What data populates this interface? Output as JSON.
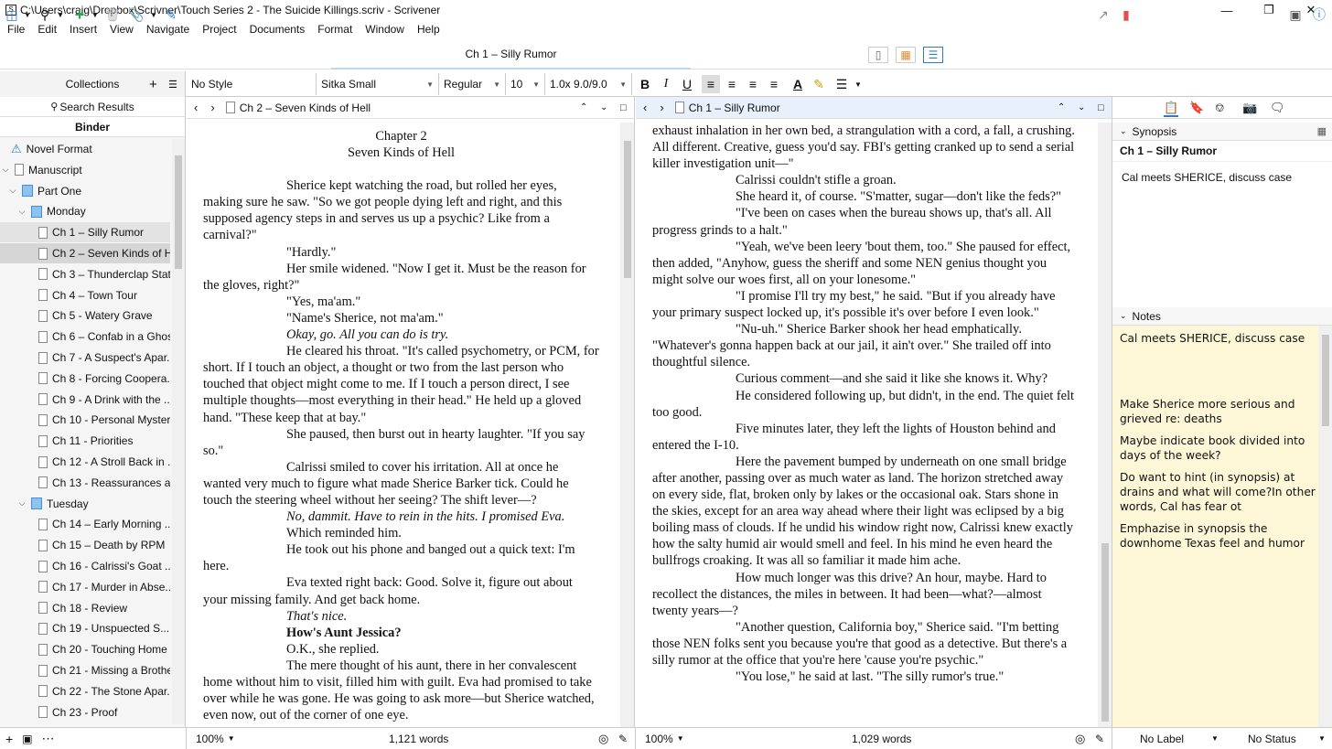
{
  "window": {
    "title": "C:\\Users\\craig\\Dropbox\\Scrivner\\Touch Series 2 - The Suicide Killings.scriv - Scrivener"
  },
  "menu": [
    "File",
    "Edit",
    "Insert",
    "View",
    "Navigate",
    "Project",
    "Documents",
    "Format",
    "Window",
    "Help"
  ],
  "toolbar": {
    "document_title": "Ch 1 – Silly Rumor"
  },
  "format": {
    "collections_label": "Collections",
    "style": "No Style",
    "font": "Sitka Small",
    "weight": "Regular",
    "size": "10",
    "spacing": "1.0x 9.0/9.0"
  },
  "binder": {
    "search_results": "Search Results",
    "tab": "Binder",
    "items": [
      {
        "label": "Novel Format",
        "level": 0,
        "kind": "warn"
      },
      {
        "label": "Manuscript",
        "level": 0,
        "kind": "doc",
        "disc": "v"
      },
      {
        "label": "Part One",
        "level": 1,
        "kind": "folder",
        "disc": "v"
      },
      {
        "label": "Monday",
        "level": 2,
        "kind": "folder",
        "disc": "v"
      },
      {
        "label": "Ch 1 – Silly Rumor",
        "level": 3,
        "kind": "doc",
        "sel": "1"
      },
      {
        "label": "Ch 2 – Seven Kinds of H...",
        "level": 3,
        "kind": "doc",
        "sel": "2"
      },
      {
        "label": "Ch 3 – Thunderclap Stat...",
        "level": 3,
        "kind": "doc"
      },
      {
        "label": "Ch 4 – Town Tour",
        "level": 3,
        "kind": "doc"
      },
      {
        "label": "Ch 5 - Watery Grave",
        "level": 3,
        "kind": "doc"
      },
      {
        "label": "Ch 6 – Confab in a Ghos...",
        "level": 3,
        "kind": "doc"
      },
      {
        "label": "Ch 7 - A Suspect's Apar...",
        "level": 3,
        "kind": "doc"
      },
      {
        "label": "Ch 8 - Forcing Coopera...",
        "level": 3,
        "kind": "doc"
      },
      {
        "label": "Ch 9 - A Drink with the ...",
        "level": 3,
        "kind": "doc"
      },
      {
        "label": "Ch 10 - Personal Myster...",
        "level": 3,
        "kind": "doc"
      },
      {
        "label": "Ch 11 - Priorities",
        "level": 3,
        "kind": "doc"
      },
      {
        "label": "Ch 12 - A Stroll Back in ...",
        "level": 3,
        "kind": "doc"
      },
      {
        "label": "Ch 13 - Reassurances a...",
        "level": 3,
        "kind": "doc"
      },
      {
        "label": "Tuesday",
        "level": 2,
        "kind": "folder",
        "disc": "v"
      },
      {
        "label": "Ch 14 – Early Morning ...",
        "level": 3,
        "kind": "doc"
      },
      {
        "label": "Ch 15 – Death by RPM",
        "level": 3,
        "kind": "doc"
      },
      {
        "label": "Ch 16 - Calrissi's Goat ...",
        "level": 3,
        "kind": "doc"
      },
      {
        "label": "Ch 17 - Murder in Abse...",
        "level": 3,
        "kind": "doc"
      },
      {
        "label": "Ch 18 - Review",
        "level": 3,
        "kind": "doc"
      },
      {
        "label": "Ch 19 - Unspuected S...",
        "level": 3,
        "kind": "doc"
      },
      {
        "label": "Ch 20 - Touching Home",
        "level": 3,
        "kind": "doc"
      },
      {
        "label": "Ch 21 - Missing a Brother",
        "level": 3,
        "kind": "doc"
      },
      {
        "label": "Ch 22 - The Stone Apar...",
        "level": 3,
        "kind": "doc"
      },
      {
        "label": "Ch 23 - Proof",
        "level": 3,
        "kind": "doc"
      }
    ]
  },
  "editor_left": {
    "header": "Ch 2 – Seven Kinds of Hell",
    "heading1": "Chapter 2",
    "heading2": "Seven Kinds of Hell",
    "paragraphs": [
      "Sherice kept watching the road, but rolled her eyes, making sure he saw. \"So we got people dying left and right, and this supposed agency steps in and serves us up a psychic? Like from a carnival?\"",
      "\"Hardly.\"",
      "Her smile widened. \"Now I get it. Must be the reason for the gloves, right?\"",
      "\"Yes, ma'am.\"",
      "\"Name's Sherice, not ma'am.\"",
      "Okay, go. All you can do is try.",
      "He cleared his throat. \"It's called psychometry, or PCM, for short. If I touch an object, a thought or two from the last person who touched that object might come to me. If I touch a person direct, I see multiple thoughts—most everything in their head.\" He held up a gloved hand. \"These keep that at bay.\"",
      "She paused, then burst out in hearty laughter. \"If you say so.\"",
      "Calrissi smiled to cover his irritation. All at once he wanted very much to figure what made Sherice Barker tick. Could he touch the steering wheel without her seeing? The shift lever—?",
      "No, dammit. Have to rein in the hits. I promised Eva.",
      "Which reminded him.",
      "He took out his phone and banged out a quick text: I'm here.",
      "Eva texted right back: Good. Solve it, figure out about your missing family. And get back home.",
      "That's nice.",
      "How's Aunt Jessica?",
      "O.K., she replied.",
      "The mere thought of his aunt, there in her convalescent home without him to visit, filled him with guilt. Eva had promised to take over while he was gone. He was going to ask more—but Sherice watched, even now, out of the corner of one eye."
    ],
    "zoom": "100%",
    "words": "1,121 words"
  },
  "editor_right": {
    "header": "Ch 1 – Silly Rumor",
    "paragraphs": [
      "exhaust inhalation in her own bed, a strangulation with a cord, a fall, a crushing. All different. Creative, guess you'd say. FBI's getting cranked up to send a serial killer investigation unit—\"",
      "Calrissi couldn't stifle a groan.",
      "She heard it, of course. \"S'matter, sugar—don't like the feds?\"",
      "\"I've been on cases when the bureau shows up, that's all. All progress grinds to a halt.\"",
      "\"Yeah, we've been leery 'bout them, too.\" She paused for effect, then added, \"Anyhow, guess the sheriff and some NEN genius thought you might solve our woes first, all on your lonesome.\"",
      "\"I promise I'll try my best,\" he said. \"But if you already have your primary suspect locked up, it's possible it's over before I even look.\"",
      "\"Nu-uh.\" Sherice Barker shook her head emphatically. \"Whatever's gonna happen back at our jail, it ain't over.\" She trailed off into thoughtful silence.",
      "Curious comment—and she said it like she knows it. Why?",
      "He considered following up, but didn't, in the end. The quiet felt too good.",
      "Five minutes later, they left the lights of Houston behind and entered the I-10.",
      "Here the pavement bumped by underneath on one small bridge after another, passing over as much water as land. The horizon stretched away on every side, flat, broken only by lakes or the occasional oak. Stars shone in the skies, except for an area way ahead where their light was eclipsed by a big boiling mass of clouds. If he undid his window right now, Calrissi knew exactly how the salty humid air would smell and feel. In his mind he even heard the bullfrogs croaking. It was all so familiar it made him ache.",
      "How much longer was this drive? An hour, maybe. Hard to recollect the distances, the miles in between. It had been—what?—almost twenty years—?",
      "\"Another question, California boy,\" Sherice said. \"I'm betting those NEN folks sent you because you're that good as a detective. But there's a silly rumor at the office that you're here 'cause you're psychic.\"",
      "\"You lose,\" he said at last. \"The silly rumor's true.\""
    ],
    "zoom": "100%",
    "words": "1,029 words"
  },
  "inspector": {
    "synopsis_label": "Synopsis",
    "synopsis_title": "Ch 1 – Silly Rumor",
    "synopsis_text": "Cal meets SHERICE, discuss case",
    "notes_label": "Notes",
    "notes": [
      "Cal meets SHERICE, discuss case",
      "Make Sherice more serious and grieved re: deaths",
      "Maybe indicate book divided into days of the week?",
      "Do want to hint (in synopsis) at drains and what will come?In other words, Cal has fear ot",
      "Emphazise in synopsis the downhome Texas feel and humor"
    ],
    "label": "No Label",
    "status": "No Status"
  },
  "colors": {
    "accent": "#4a90d9",
    "notes_bg": "#fdf7d8",
    "bookmark": "#e05050"
  }
}
